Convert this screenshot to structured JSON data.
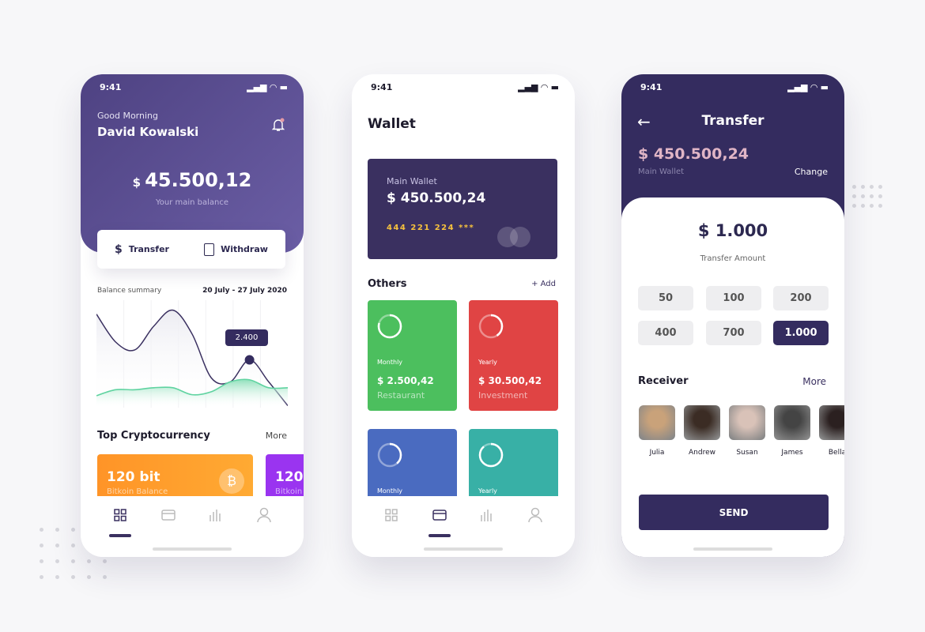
{
  "colors": {
    "primary": "#342c5f",
    "header_purple": "#5d4f95",
    "green": "#4cbf5e",
    "red": "#e04444",
    "blue": "#4a6bc0",
    "teal": "#38b0a6",
    "orange": "#ff9a2e",
    "accent_green": "#5fd3a0"
  },
  "status_time": "9:41",
  "home": {
    "greeting": "Good Morning",
    "name": "David Kowalski",
    "currency": "$",
    "balance": "45.500,12",
    "balance_label": "Your main balance",
    "actions": [
      {
        "label": "Transfer",
        "icon": "coins-icon"
      },
      {
        "label": "Withdraw",
        "icon": "withdraw-icon"
      }
    ],
    "summary_label": "Balance summary",
    "date_range": "20 July - 27 July 2020",
    "section_title": "Top Cryptocurrency",
    "more": "More",
    "crypto": [
      {
        "amount": "120 bit",
        "label": "Bitkoin Balance"
      },
      {
        "amount": "120",
        "label": "Bitkoin"
      }
    ]
  },
  "chart_data": {
    "type": "line",
    "tooltip": "2.400",
    "ylim": [
      0,
      5.4
    ],
    "series": [
      {
        "values": [
          4.7,
          3.3,
          2.9,
          4.1,
          4.9,
          3.7,
          1.5,
          1.3,
          2.4,
          1.3,
          0.1
        ]
      },
      {
        "values": [
          0.6,
          0.9,
          0.9,
          1.0,
          1.0,
          0.65,
          0.8,
          1.3,
          1.4,
          1.0,
          1.0
        ]
      }
    ],
    "highlight_index": 8
  },
  "wallet": {
    "title": "Wallet",
    "card_label": "Main Wallet",
    "card_balance": "$ 450.500,24",
    "card_number": "444 221 224 ***",
    "others": "Others",
    "add": "+ Add",
    "items": [
      {
        "period": "Monthly",
        "amount": "$ 2.500,42",
        "category": "Restaurant"
      },
      {
        "period": "Yearly",
        "amount": "$ 30.500,42",
        "category": "Investment"
      },
      {
        "period": "Monthly"
      },
      {
        "period": "Yearly"
      }
    ]
  },
  "transfer": {
    "title": "Transfer",
    "balance": "$ 450.500,24",
    "wallet_label": "Main Wallet",
    "change": "Change",
    "amount": "$ 1.000",
    "amount_label": "Transfer Amount",
    "options": [
      "50",
      "100",
      "200",
      "400",
      "700",
      "1.000"
    ],
    "selected": "1.000",
    "receiver": "Receiver",
    "more": "More",
    "receivers": [
      "Julia",
      "Andrew",
      "Susan",
      "James",
      "Bella"
    ],
    "send": "SEND"
  }
}
